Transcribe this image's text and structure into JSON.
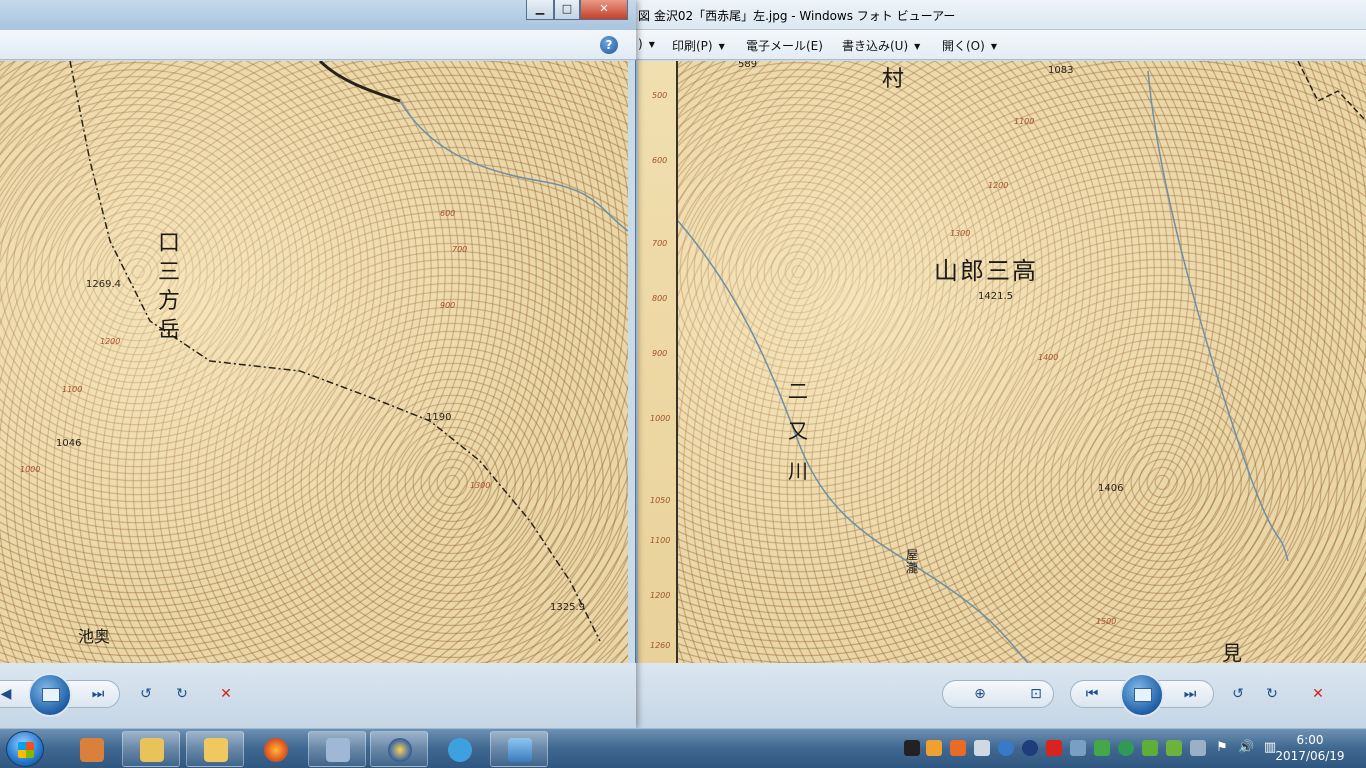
{
  "right_window": {
    "title": "図 金沢02「西赤尾」左.jpg - Windows フォト ビューアー",
    "menu": {
      "file_partial": ")",
      "print": "印刷(P)",
      "email": "電子メール(E)",
      "burn": "書き込み(U)",
      "open": "開く(O)"
    },
    "map": {
      "place_labels": {
        "village": "村",
        "mountain": "山郎三高",
        "river": "二又川",
        "waterfall": "屋瀧",
        "edge": "見"
      },
      "elevations": {
        "e1": "589",
        "e2": "1083",
        "e3": "1421.5",
        "e4": "1406"
      },
      "scale_ticks": [
        "500",
        "600",
        "700",
        "800",
        "900",
        "1000",
        "1050",
        "1100",
        "1200",
        "1260"
      ],
      "contours": [
        "1100",
        "1200",
        "1300",
        "1400",
        "1500"
      ]
    }
  },
  "left_window": {
    "map": {
      "place_labels": {
        "peak": "口三方岳",
        "village": "池奥"
      },
      "elevations": {
        "e1": "1269.4",
        "e2": "1046",
        "e3": "1190",
        "e4": "1325.9"
      },
      "contours": [
        "600",
        "700",
        "900",
        "1000",
        "1100",
        "1200",
        "1300"
      ]
    }
  },
  "taskbar": {
    "clock_time": "6:00",
    "clock_date": "2017/06/19"
  },
  "colors": {
    "taskbar": "#3f6790",
    "map_paper": "#ead7a8",
    "contour": "#a2522a"
  },
  "icons": {
    "help": "help-icon",
    "prev": "previous-icon",
    "next": "next-icon",
    "rotate_ccw": "rotate-left-icon",
    "rotate_cw": "rotate-right-icon",
    "delete": "delete-icon",
    "zoom": "zoom-icon",
    "fit": "actual-size-icon"
  }
}
